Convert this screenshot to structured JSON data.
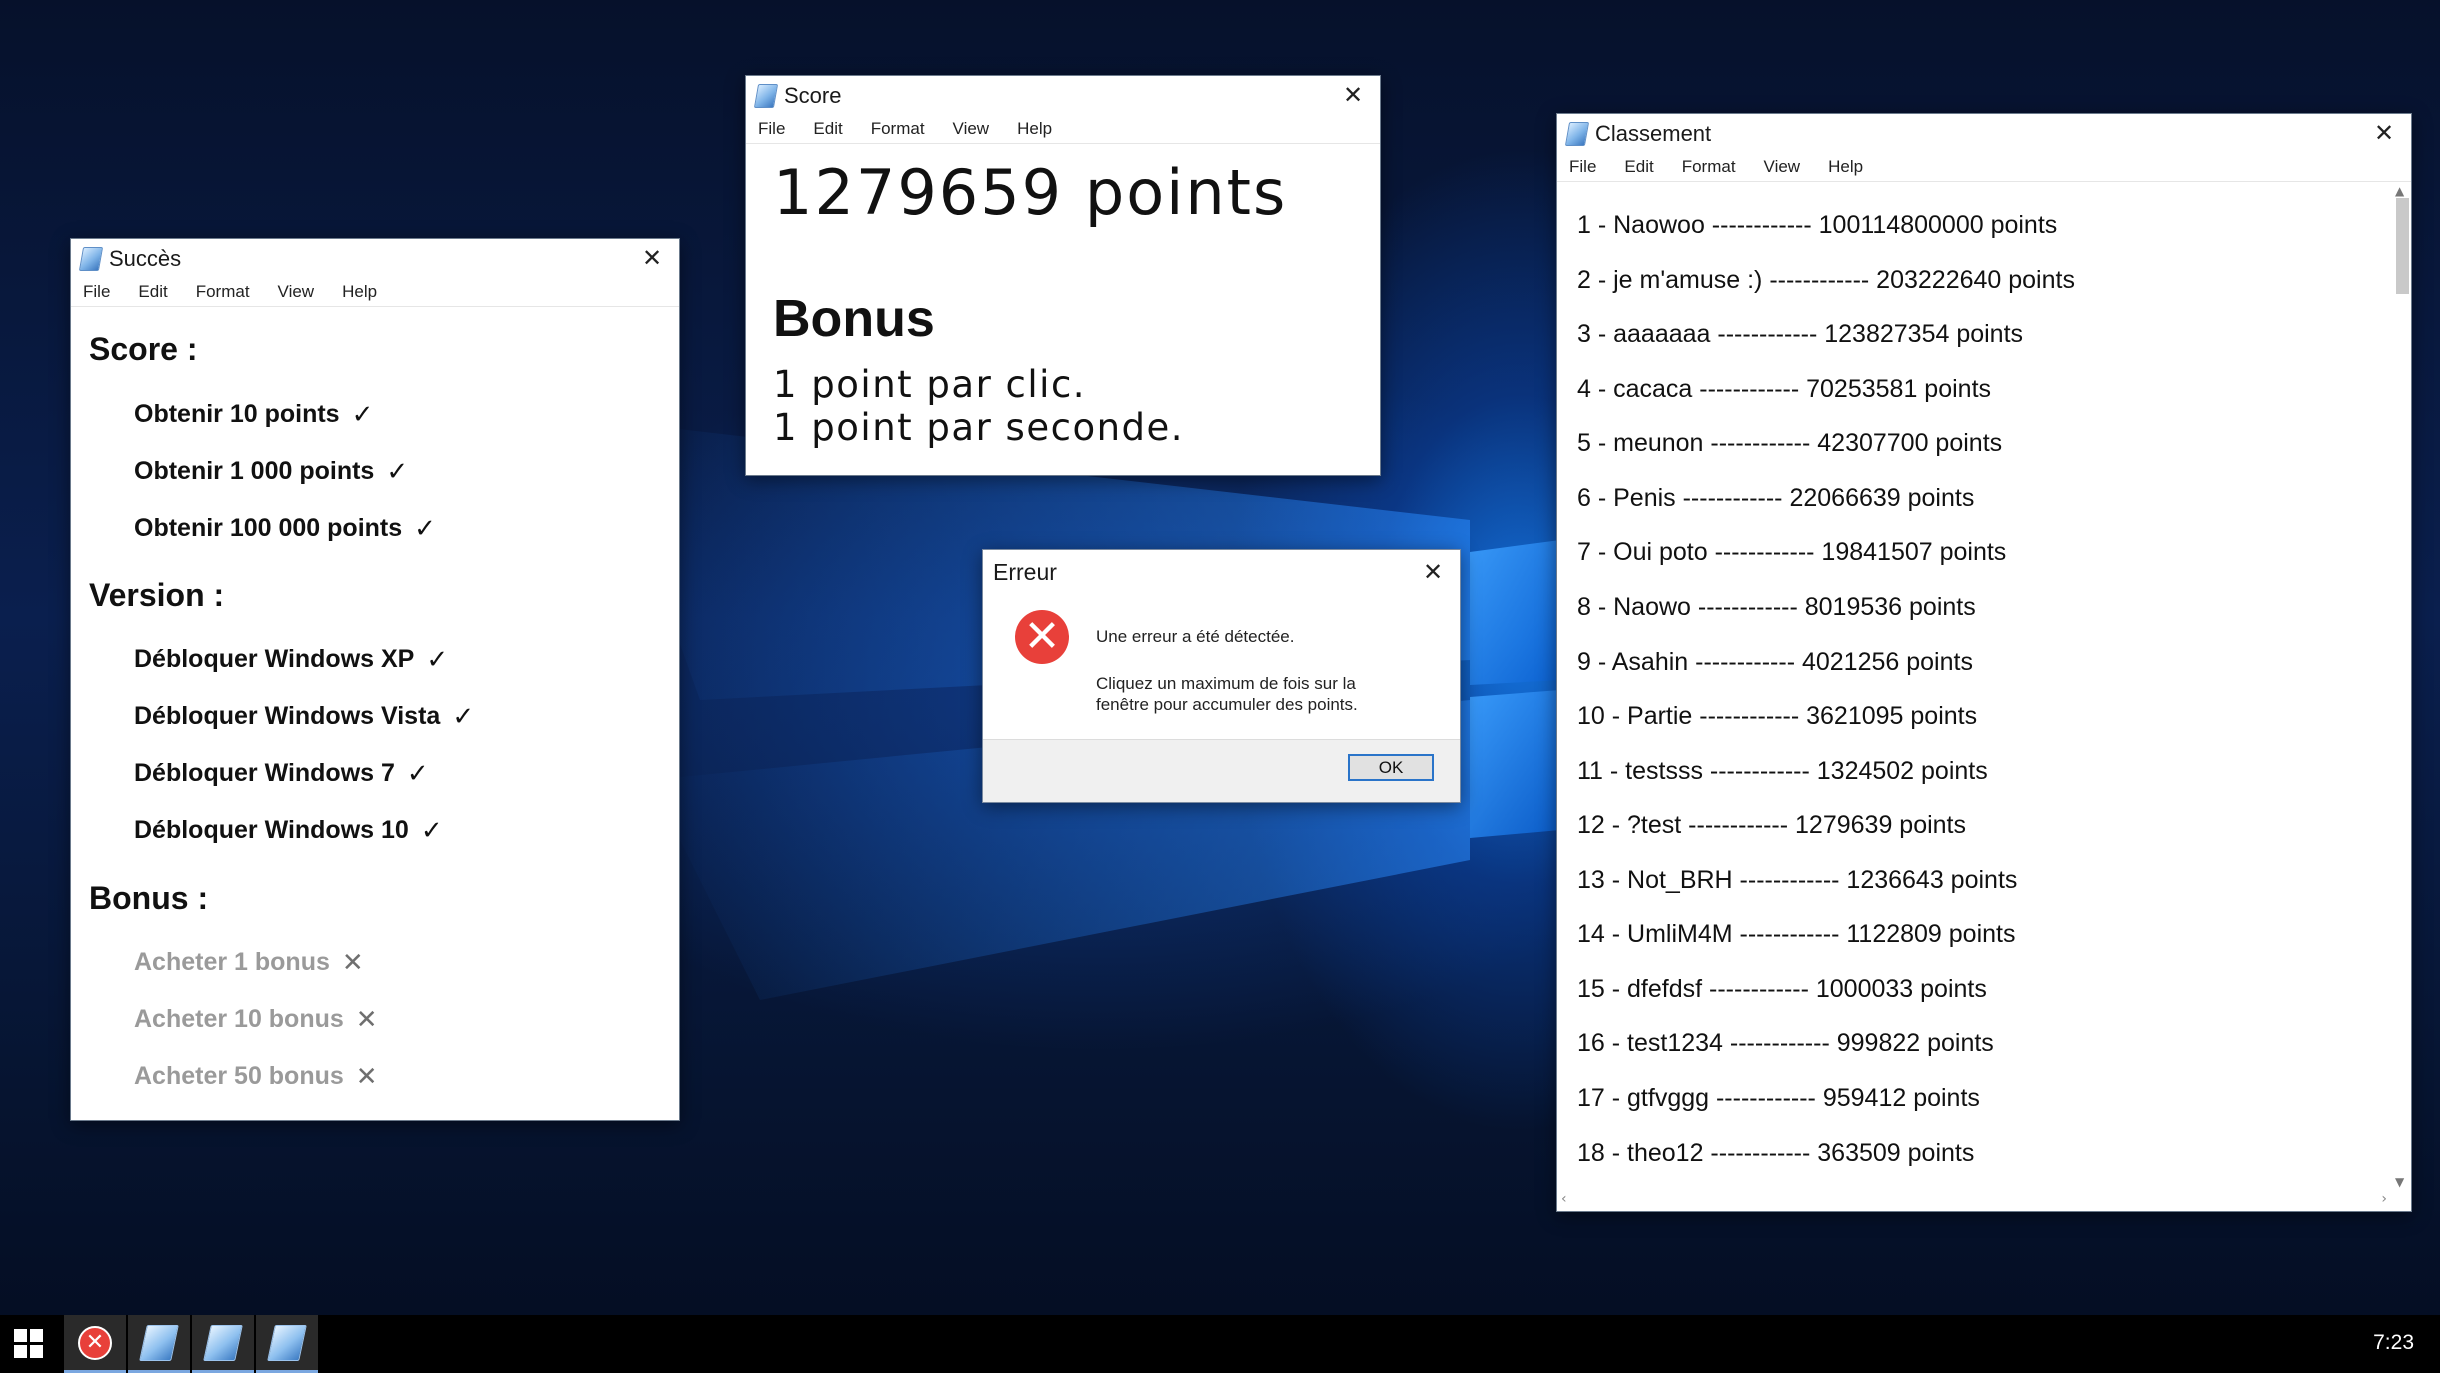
{
  "windows": {
    "succes": {
      "title": "Succès",
      "menu": [
        "File",
        "Edit",
        "Format",
        "View",
        "Help"
      ],
      "sections": [
        {
          "heading": "Score :",
          "items": [
            {
              "label": "Obtenir 10 points",
              "done": true
            },
            {
              "label": "Obtenir 1 000 points",
              "done": true
            },
            {
              "label": "Obtenir 100 000 points",
              "done": true
            }
          ]
        },
        {
          "heading": "Version :",
          "items": [
            {
              "label": "Débloquer Windows XP",
              "done": true
            },
            {
              "label": "Débloquer Windows Vista",
              "done": true
            },
            {
              "label": "Débloquer Windows 7",
              "done": true
            },
            {
              "label": "Débloquer Windows 10",
              "done": true
            }
          ]
        },
        {
          "heading": "Bonus :",
          "items": [
            {
              "label": "Acheter 1 bonus",
              "done": false
            },
            {
              "label": "Acheter 10 bonus",
              "done": false
            },
            {
              "label": "Acheter 50 bonus",
              "done": false
            }
          ]
        }
      ],
      "check_mark": "✓",
      "cross_mark": "✕"
    },
    "score": {
      "title": "Score",
      "menu": [
        "File",
        "Edit",
        "Format",
        "View",
        "Help"
      ],
      "points_text": "1279659 points",
      "bonus_heading": "Bonus",
      "bonus_lines": [
        "1 point par clic.",
        "1 point par seconde."
      ]
    },
    "erreur": {
      "title": "Erreur",
      "message_line1": "Une erreur a été détectée.",
      "message_line2": "Cliquez un maximum de fois sur la",
      "message_line3": "fenêtre pour accumuler des points.",
      "ok_label": "OK"
    },
    "classement": {
      "title": "Classement",
      "menu": [
        "File",
        "Edit",
        "Format",
        "View",
        "Help"
      ],
      "rows": [
        "1 - Naowoo ------------ 100114800000 points",
        "2 - je m'amuse :) ------------ 203222640 points",
        "3 - aaaaaaa ------------ 123827354 points",
        "4 - cacaca ------------ 70253581 points",
        "5 - meunon ------------ 42307700 points",
        "6 - Penis ------------ 22066639 points",
        "7 - Oui poto ------------ 19841507 points",
        "8 - Naowo ------------ 8019536 points",
        "9 - Asahin ------------ 4021256 points",
        "10 - Partie ------------ 3621095 points",
        "11 - testsss ------------ 1324502 points",
        "12 - ?test ------------ 1279639 points",
        "13 - Not_BRH ------------ 1236643 points",
        "14 - UmliM4M ------------ 1122809 points",
        "15 - dfefdsf ------------ 1000033 points",
        "16 - test1234 ------------ 999822 points",
        "17 - gtfvggg ------------ 959412 points",
        "18 - theo12 ------------ 363509 points"
      ]
    }
  },
  "close_glyph": "✕",
  "taskbar": {
    "clock": "7:23",
    "buttons": [
      "error-app",
      "notepad",
      "notepad",
      "notepad"
    ]
  },
  "colors": {
    "error_red": "#e8403a",
    "ok_button_border": "#2a74c9",
    "disabled_text": "#9a9a9a"
  }
}
